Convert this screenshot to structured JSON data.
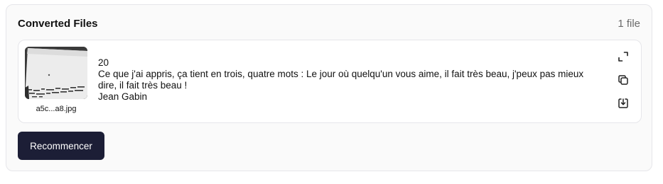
{
  "converted_files": {
    "title": "Converted Files",
    "count_label": "1 file"
  },
  "file": {
    "thumbnail_name": "a5c...a8.jpg",
    "text_lines": [
      "20",
      "Ce que j'ai appris, ça tient en trois, quatre mots : Le jour où quelqu'un vous aime, il fait très beau, j'peux pas mieux",
      "dire, il fait très beau !",
      "Jean Gabin"
    ],
    "actions": [
      "expand-icon",
      "copy-icon",
      "download-icon"
    ]
  },
  "restart_button": {
    "label": "Recommencer"
  },
  "colors": {
    "button_bg": "#1c1e36",
    "panel_bg": "#fafafa",
    "border": "#e6e6ea"
  }
}
